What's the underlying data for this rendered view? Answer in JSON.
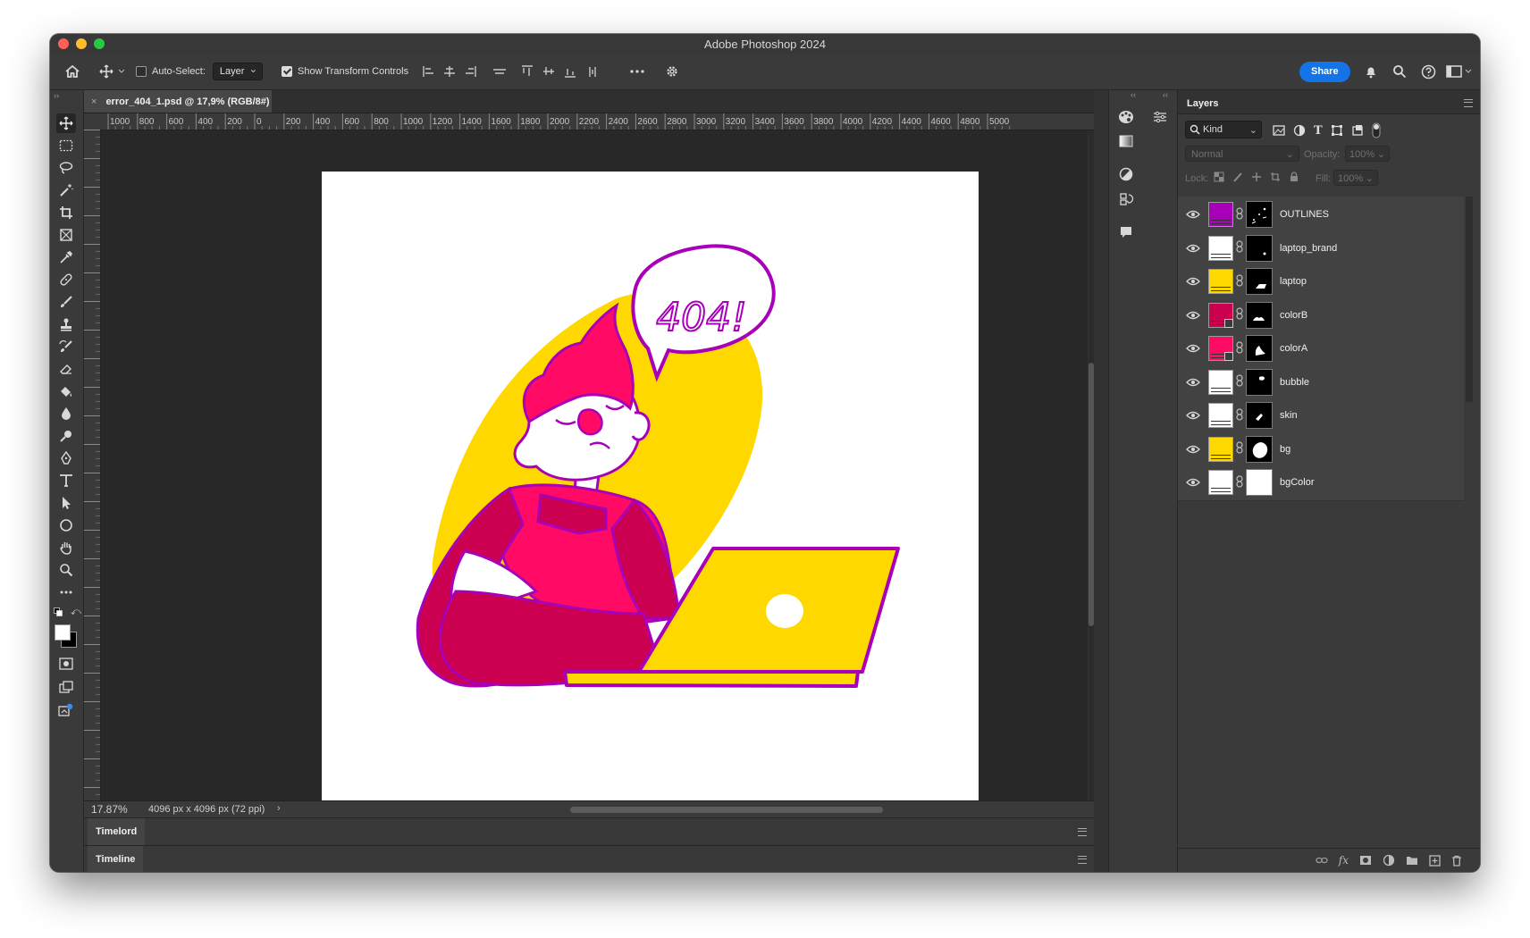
{
  "window": {
    "title": "Adobe Photoshop 2024"
  },
  "options_bar": {
    "auto_select_label": "Auto-Select:",
    "auto_select_value": "Layer",
    "show_transform_label": "Show Transform Controls",
    "share_label": "Share"
  },
  "document": {
    "tab_title": "error_404_1.psd @ 17,9% (RGB/8#)",
    "zoom": "17.87%",
    "info": "4096 px x 4096 px (72 ppi)",
    "ruler_labels": [
      "1000",
      "800",
      "600",
      "400",
      "200",
      "0",
      "200",
      "400",
      "600",
      "800",
      "1000",
      "1200",
      "1400",
      "1600",
      "1800",
      "2000",
      "2200",
      "2400",
      "2600",
      "2800",
      "3000",
      "3200",
      "3400",
      "3600",
      "3800",
      "4000",
      "4200",
      "4400",
      "4600",
      "4800",
      "5000"
    ],
    "artwork_text": "404!"
  },
  "bottom_panels": [
    {
      "label": "Timelord"
    },
    {
      "label": "Timeline"
    }
  ],
  "layers_panel": {
    "title": "Layers",
    "filter_kind": "Kind",
    "blend_mode": "Normal",
    "opacity_label": "Opacity:",
    "opacity_value": "100%",
    "lock_label": "Lock:",
    "fill_label": "Fill:",
    "fill_value": "100%",
    "layers": [
      {
        "name": "OUTLINES",
        "color": "#a800b8"
      },
      {
        "name": "laptop_brand",
        "color": "#ffffff"
      },
      {
        "name": "laptop",
        "color": "#ffd800"
      },
      {
        "name": "colorB",
        "color": "#cc0050"
      },
      {
        "name": "colorA",
        "color": "#ff0a64"
      },
      {
        "name": "bubble",
        "color": "#ffffff"
      },
      {
        "name": "skin",
        "color": "#ffffff"
      },
      {
        "name": "bg",
        "color": "#ffd800"
      },
      {
        "name": "bgColor",
        "color": "#ffffff"
      }
    ]
  },
  "colors": {
    "outline": "#a800b8",
    "yellow": "#ffd800",
    "pink": "#ff0a64",
    "crimson": "#cc0050",
    "accent": "#1473e6"
  }
}
